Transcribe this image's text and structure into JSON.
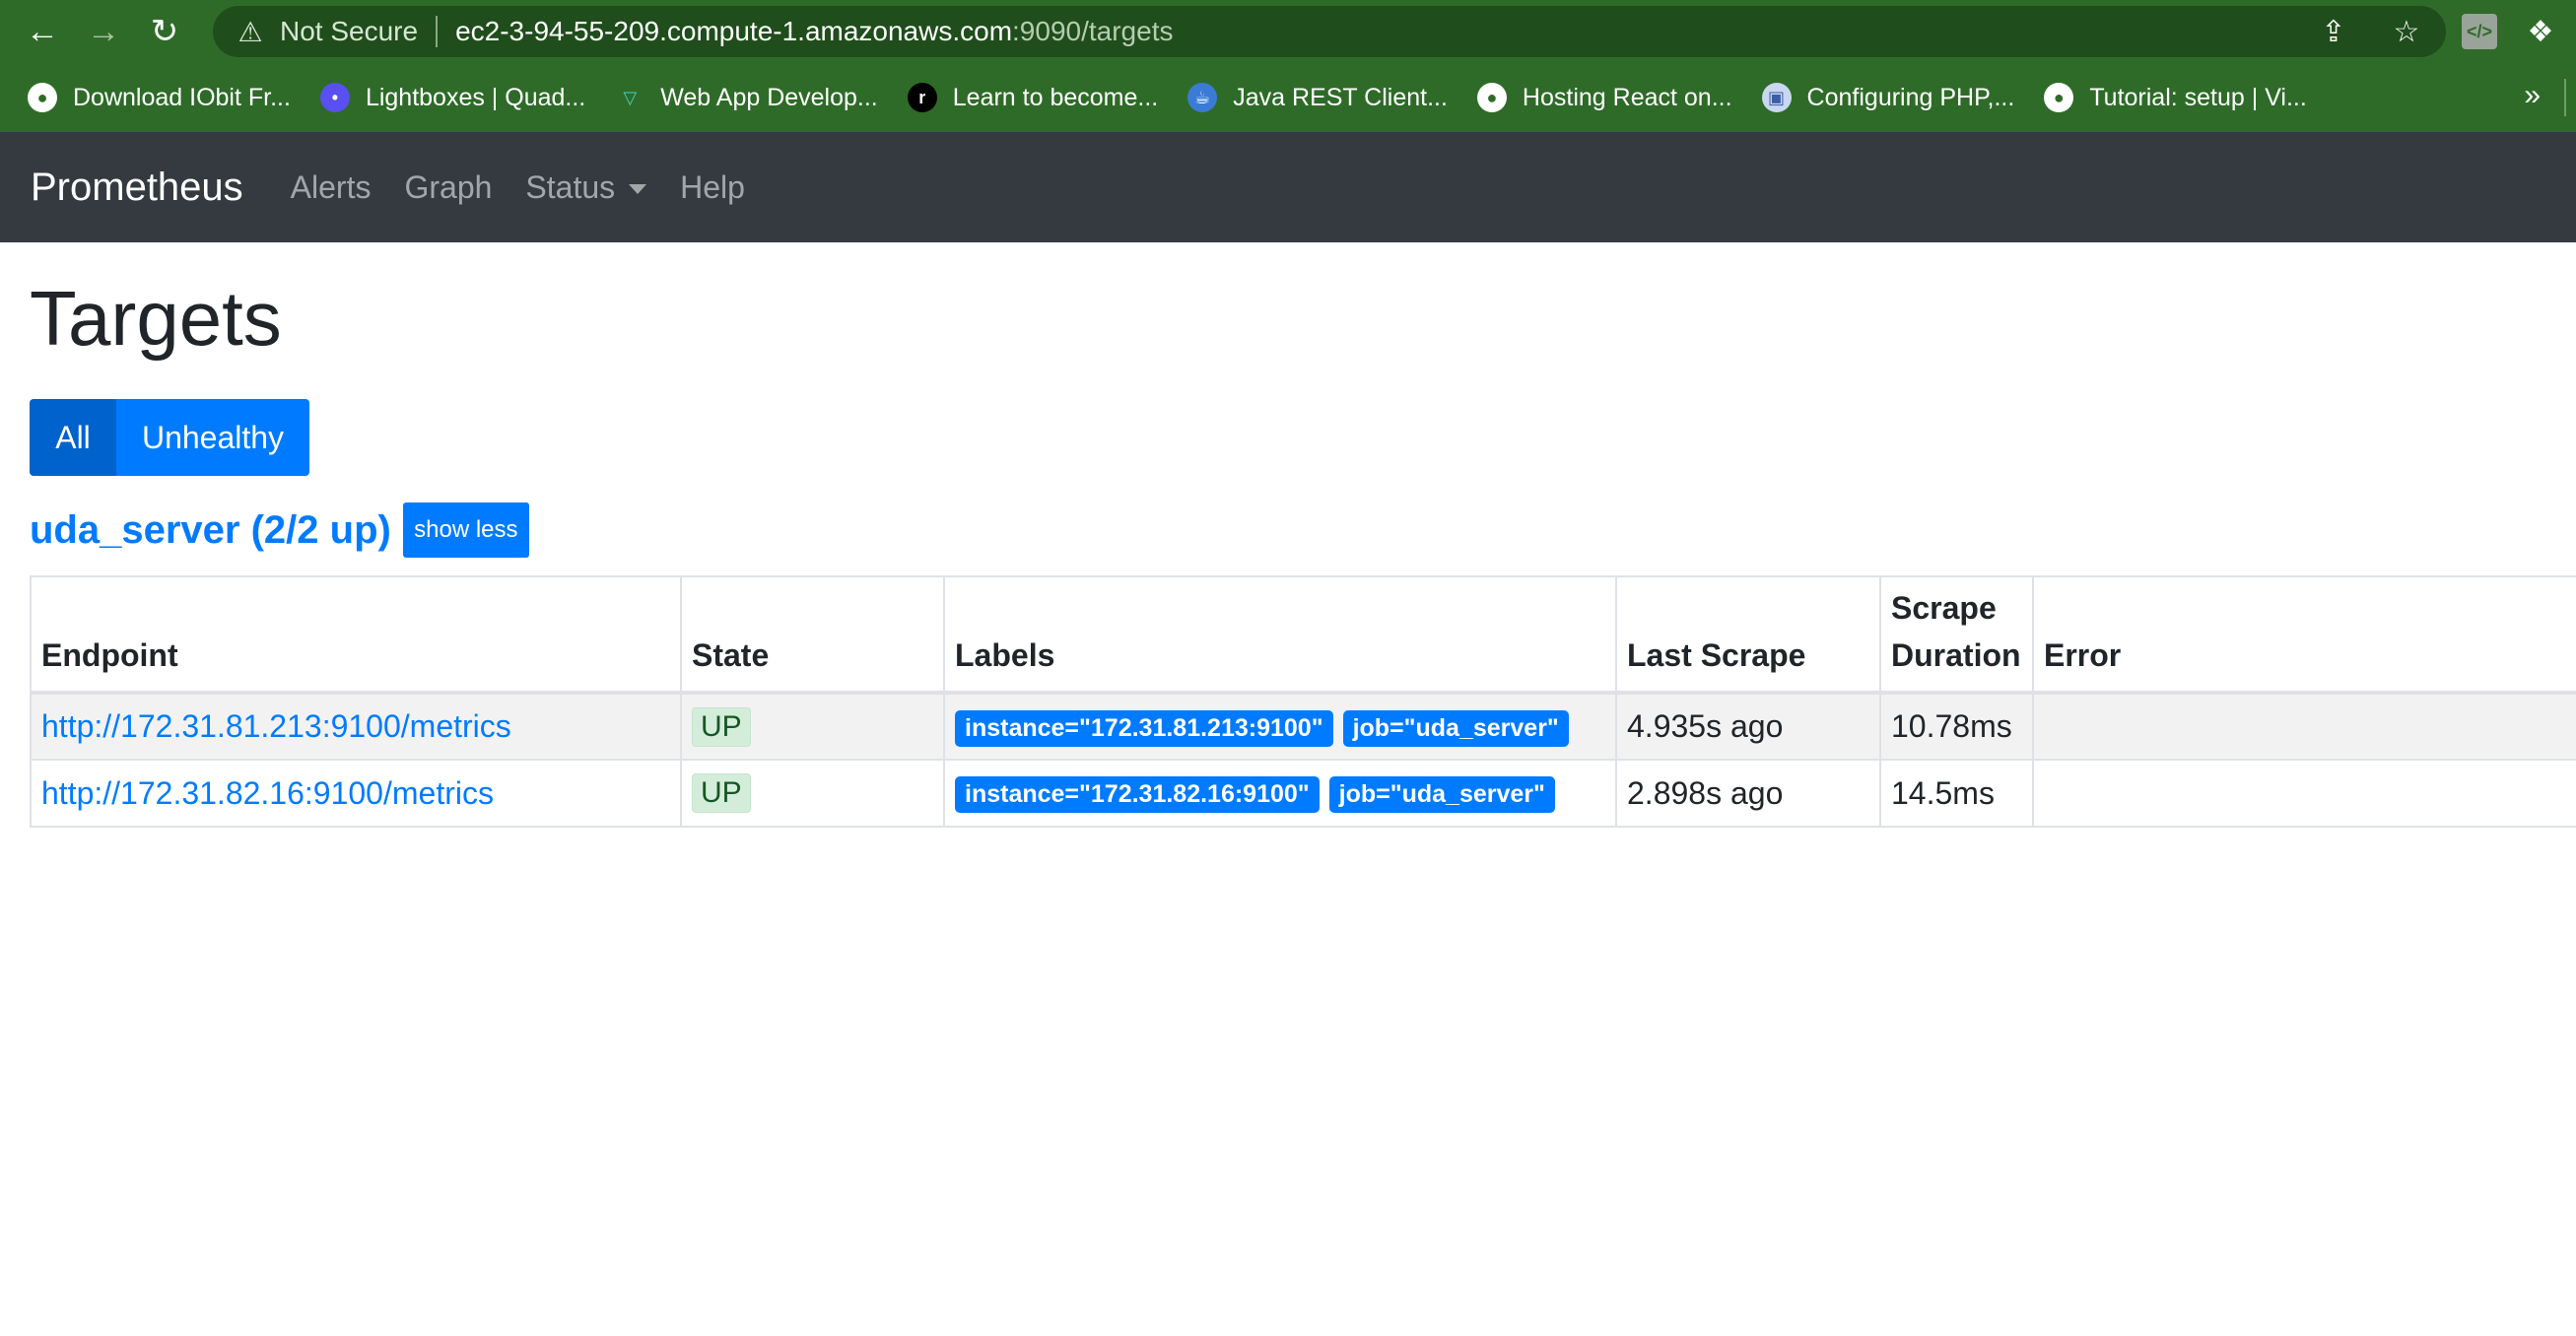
{
  "browser": {
    "not_secure": "Not Secure",
    "url_host": "ec2-3-94-55-209.compute-1.amazonaws.com",
    "url_rest": ":9090/targets",
    "bookmarks": [
      {
        "label": "Download IObit Fr...",
        "icon": "globe-icon"
      },
      {
        "label": "Lightboxes | Quad...",
        "icon": "purple-circle-icon"
      },
      {
        "label": "Web App Develop...",
        "icon": "vue-logo-icon"
      },
      {
        "label": "Learn to become...",
        "icon": "r-logo-icon"
      },
      {
        "label": "Java REST Client...",
        "icon": "java-icon"
      },
      {
        "label": "Hosting React on...",
        "icon": "globe-icon"
      },
      {
        "label": "Configuring PHP,...",
        "icon": "cube-icon"
      },
      {
        "label": "Tutorial: setup | Vi...",
        "icon": "globe-icon"
      }
    ],
    "more": "»"
  },
  "navbar": {
    "brand": "Prometheus",
    "links": [
      "Alerts",
      "Graph",
      "Status",
      "Help"
    ]
  },
  "page": {
    "title": "Targets",
    "filter_all": "All",
    "filter_unhealthy": "Unhealthy"
  },
  "job": {
    "title": "uda_server (2/2 up)",
    "toggle": "show less"
  },
  "table": {
    "headers": {
      "endpoint": "Endpoint",
      "state": "State",
      "labels": "Labels",
      "last_scrape": "Last Scrape",
      "scrape_duration_1": "Scrape",
      "scrape_duration_2": "Duration",
      "error": "Error"
    },
    "rows": [
      {
        "endpoint": "http://172.31.81.213:9100/metrics",
        "state": "UP",
        "instance": "instance=\"172.31.81.213:9100\"",
        "job": "job=\"uda_server\"",
        "last_scrape": "4.935s ago",
        "duration": "10.78ms",
        "error": ""
      },
      {
        "endpoint": "http://172.31.82.16:9100/metrics",
        "state": "UP",
        "instance": "instance=\"172.31.82.16:9100\"",
        "job": "job=\"uda_server\"",
        "last_scrape": "2.898s ago",
        "duration": "14.5ms",
        "error": ""
      }
    ]
  },
  "colors": {
    "browser_chrome": "#2e6b28",
    "navbar_bg": "#343a40",
    "primary": "#007bff",
    "active": "#0062cc",
    "up_badge_bg": "#d4edda"
  }
}
